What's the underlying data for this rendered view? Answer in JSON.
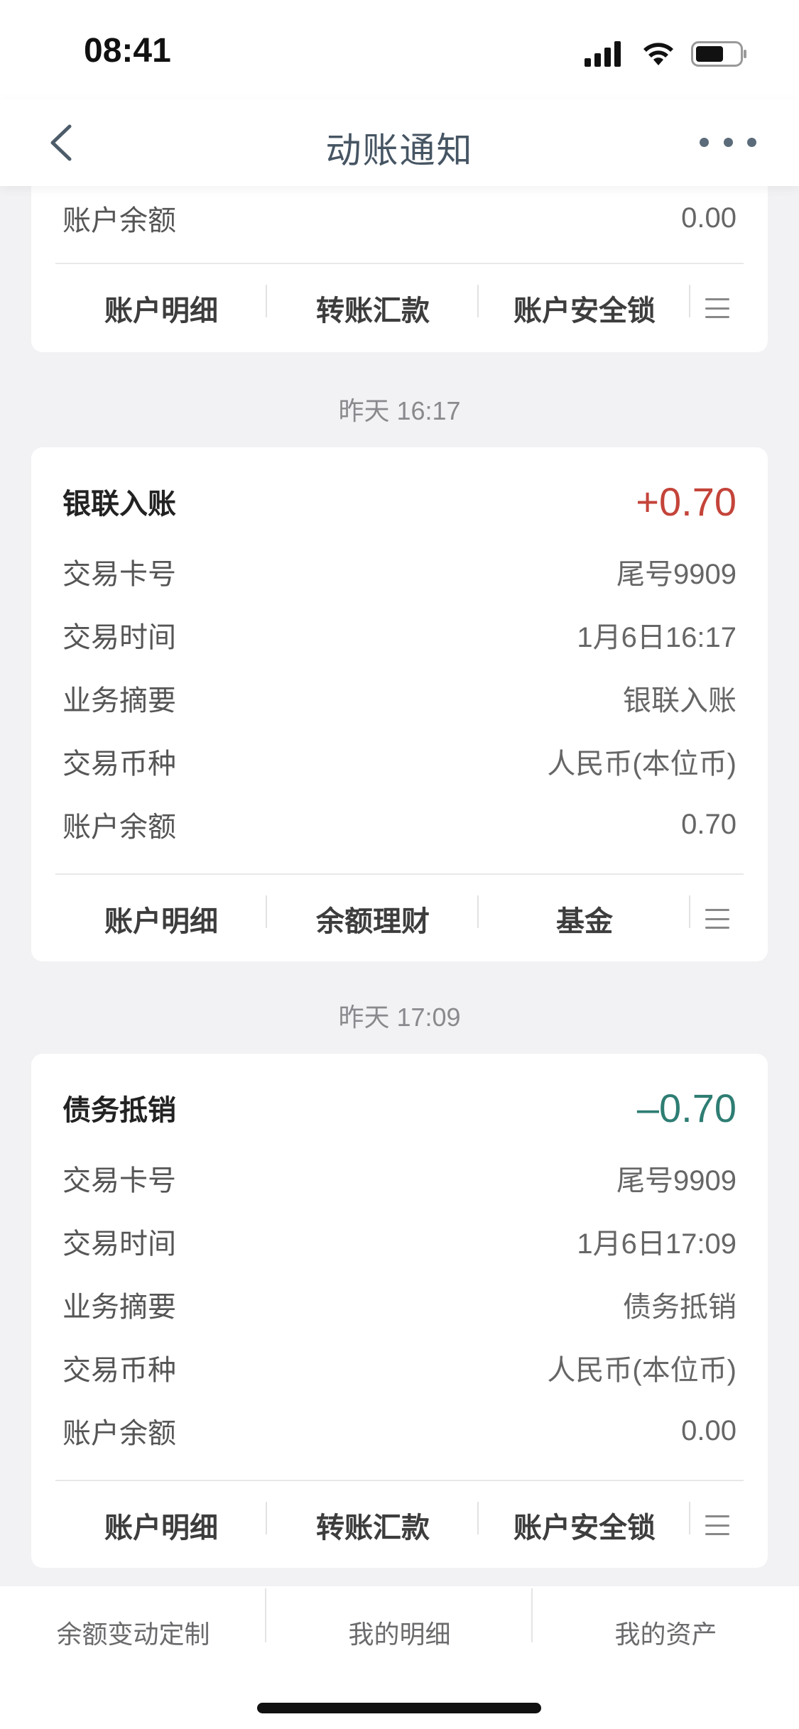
{
  "status_bar": {
    "time": "08:41"
  },
  "nav": {
    "title": "动账通知"
  },
  "colors": {
    "amount_positive": "#c4443a",
    "amount_negative": "#2e7d73"
  },
  "top_card": {
    "balance_label": "账户余额",
    "balance_value": "0.00",
    "actions": [
      "账户明细",
      "转账汇款",
      "账户安全锁"
    ]
  },
  "notices": [
    {
      "date": "昨天  16:17",
      "title": "银联入账",
      "amount": "+0.70",
      "rows": [
        {
          "label": "交易卡号",
          "value": "尾号9909"
        },
        {
          "label": "交易时间",
          "value": "1月6日16:17"
        },
        {
          "label": "业务摘要",
          "value": "银联入账"
        },
        {
          "label": "交易币种",
          "value": "人民币(本位币)"
        },
        {
          "label": "账户余额",
          "value": "0.70"
        }
      ],
      "actions": [
        "账户明细",
        "余额理财",
        "基金"
      ]
    },
    {
      "date": "昨天  17:09",
      "title": "债务抵销",
      "amount": "–0.70",
      "rows": [
        {
          "label": "交易卡号",
          "value": "尾号9909"
        },
        {
          "label": "交易时间",
          "value": "1月6日17:09"
        },
        {
          "label": "业务摘要",
          "value": "债务抵销"
        },
        {
          "label": "交易币种",
          "value": "人民币(本位币)"
        },
        {
          "label": "账户余额",
          "value": "0.00"
        }
      ],
      "actions": [
        "账户明细",
        "转账汇款",
        "账户安全锁"
      ]
    }
  ],
  "bottom_tabs": [
    "余额变动定制",
    "我的明细",
    "我的资产"
  ]
}
